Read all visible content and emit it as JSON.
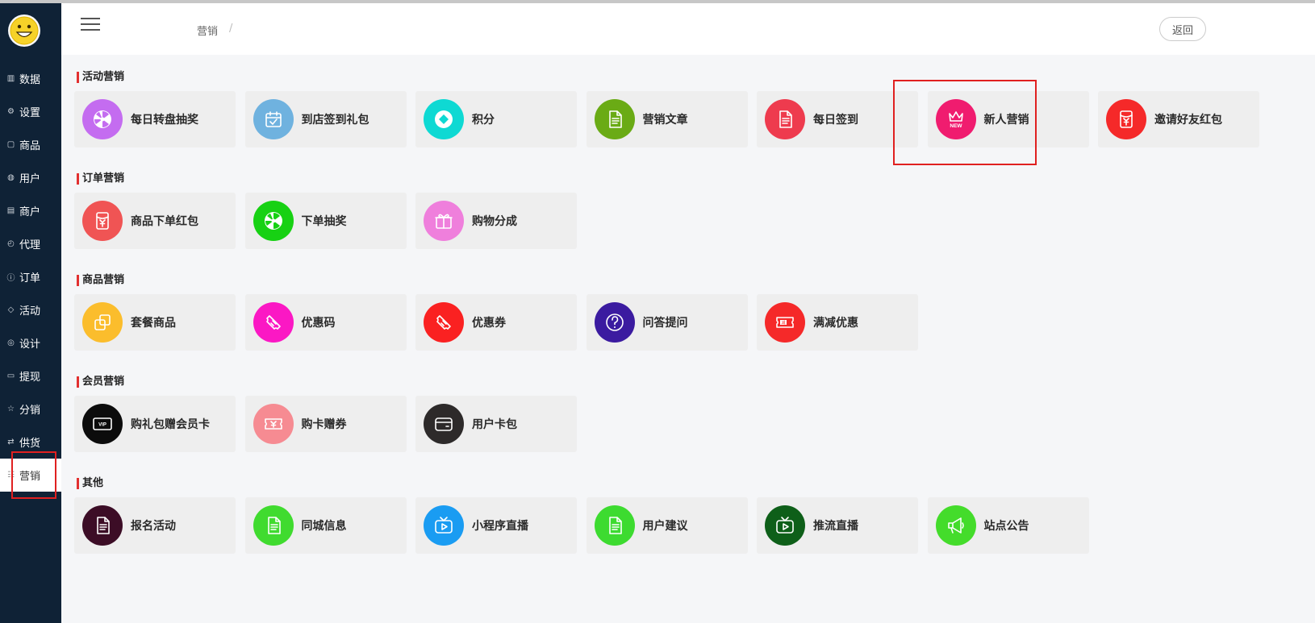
{
  "sidebar": {
    "items": [
      {
        "label": "数据",
        "icon": "chart-icon"
      },
      {
        "label": "设置",
        "icon": "gear-icon"
      },
      {
        "label": "商品",
        "icon": "box-icon"
      },
      {
        "label": "用户",
        "icon": "user-icon"
      },
      {
        "label": "商户",
        "icon": "store-icon"
      },
      {
        "label": "代理",
        "icon": "clock-icon"
      },
      {
        "label": "订单",
        "icon": "info-icon"
      },
      {
        "label": "活动",
        "icon": "tag-icon"
      },
      {
        "label": "设计",
        "icon": "palette-icon"
      },
      {
        "label": "提现",
        "icon": "card-icon"
      },
      {
        "label": "分销",
        "icon": "star-icon"
      },
      {
        "label": "供货",
        "icon": "swap-icon"
      },
      {
        "label": "营销",
        "icon": "marketing-icon"
      }
    ]
  },
  "header": {
    "breadcrumb": "营销",
    "breadcrumb_sep": "/",
    "back_label": "返回"
  },
  "sections": [
    {
      "title": "活动营销",
      "items": [
        {
          "label": "每日转盘抽奖",
          "color": "#c46cf0",
          "icon": "wheel-icon"
        },
        {
          "label": "到店签到礼包",
          "color": "#6fb2df",
          "icon": "calendar-icon"
        },
        {
          "label": "积分",
          "color": "#0ed9d3",
          "icon": "diamond-icon"
        },
        {
          "label": "营销文章",
          "color": "#6aab15",
          "icon": "document-icon"
        },
        {
          "label": "每日签到",
          "color": "#ee3b4e",
          "icon": "document-icon"
        },
        {
          "label": "新人营销",
          "color": "#f01c6f",
          "icon": "crown-new-icon"
        },
        {
          "label": "邀请好友红包",
          "color": "#f52929",
          "icon": "red-envelope-icon"
        }
      ]
    },
    {
      "title": "订单营销",
      "items": [
        {
          "label": "商品下单红包",
          "color": "#f05454",
          "icon": "red-envelope-icon"
        },
        {
          "label": "下单抽奖",
          "color": "#17d113",
          "icon": "wheel-icon"
        },
        {
          "label": "购物分成",
          "color": "#ef7fdc",
          "icon": "gift-icon"
        }
      ]
    },
    {
      "title": "商品营销",
      "items": [
        {
          "label": "套餐商品",
          "color": "#fbbd2c",
          "icon": "squares-icon"
        },
        {
          "label": "优惠码",
          "color": "#fb18c4",
          "icon": "ticket-icon"
        },
        {
          "label": "优惠券",
          "color": "#fa2121",
          "icon": "ticket-icon"
        },
        {
          "label": "问答提问",
          "color": "#3b1ba0",
          "icon": "question-icon"
        },
        {
          "label": "满减优惠",
          "color": "#f52929",
          "icon": "discount-icon"
        }
      ]
    },
    {
      "title": "会员营销",
      "items": [
        {
          "label": "购礼包赠会员卡",
          "color": "#0c0c0c",
          "icon": "vip-card-icon"
        },
        {
          "label": "购卡赠券",
          "color": "#f68b92",
          "icon": "coupon-icon"
        },
        {
          "label": "用户卡包",
          "color": "#2d2a2a",
          "icon": "wallet-icon"
        }
      ]
    },
    {
      "title": "其他",
      "items": [
        {
          "label": "报名活动",
          "color": "#3c0d26",
          "icon": "document-icon"
        },
        {
          "label": "同城信息",
          "color": "#40db2f",
          "icon": "document-icon"
        },
        {
          "label": "小程序直播",
          "color": "#1a9cf2",
          "icon": "tv-icon"
        },
        {
          "label": "用户建议",
          "color": "#3ddb30",
          "icon": "document-icon"
        },
        {
          "label": "推流直播",
          "color": "#0e5f19",
          "icon": "tv-icon"
        },
        {
          "label": "站点公告",
          "color": "#44dc2b",
          "icon": "megaphone-icon"
        }
      ]
    }
  ]
}
